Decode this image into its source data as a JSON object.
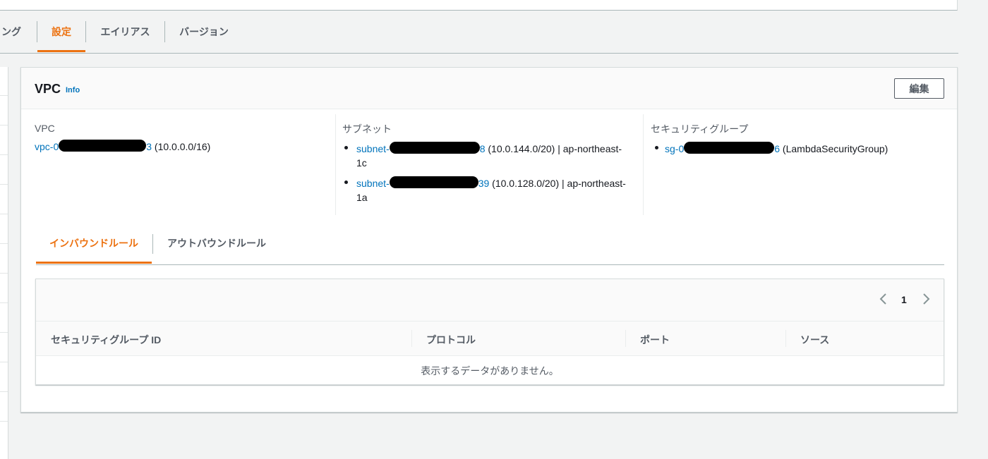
{
  "main_tabs": [
    {
      "label": "ング",
      "active": false
    },
    {
      "label": "設定",
      "active": true
    },
    {
      "label": "エイリアス",
      "active": false
    },
    {
      "label": "バージョン",
      "active": false
    }
  ],
  "vpc_card": {
    "title": "VPC",
    "info": "Info",
    "edit_label": "編集",
    "vpc": {
      "label": "VPC",
      "link_prefix": "vpc-0",
      "link_suffix": "3",
      "cidr": "(10.0.0.0/16)"
    },
    "subnets": {
      "label": "サブネット",
      "items": [
        {
          "prefix": "subnet-",
          "suffix": "8",
          "detail": "(10.0.144.0/20) | ap-northeast-",
          "wrap": "1c"
        },
        {
          "prefix": "subnet-",
          "suffix": "39",
          "detail": "(10.0.128.0/20) | ap-northeast-",
          "wrap": "1a"
        }
      ]
    },
    "security_groups": {
      "label": "セキュリティグループ",
      "items": [
        {
          "prefix": "sg-0",
          "suffix": "6",
          "detail": "(LambdaSecurityGroup)"
        }
      ]
    }
  },
  "rule_tabs": [
    {
      "label": "インバウンドルール",
      "active": true
    },
    {
      "label": "アウトバウンドルール",
      "active": false
    }
  ],
  "rules_table": {
    "pagination": {
      "current_page": "1"
    },
    "columns": [
      "セキュリティグループ ID",
      "プロトコル",
      "ポート",
      "ソース"
    ],
    "empty_message": "表示するデータがありません。"
  },
  "colors": {
    "accent": "#ec7211",
    "link": "#0073bb",
    "text": "#16191f",
    "muted": "#545b64"
  }
}
